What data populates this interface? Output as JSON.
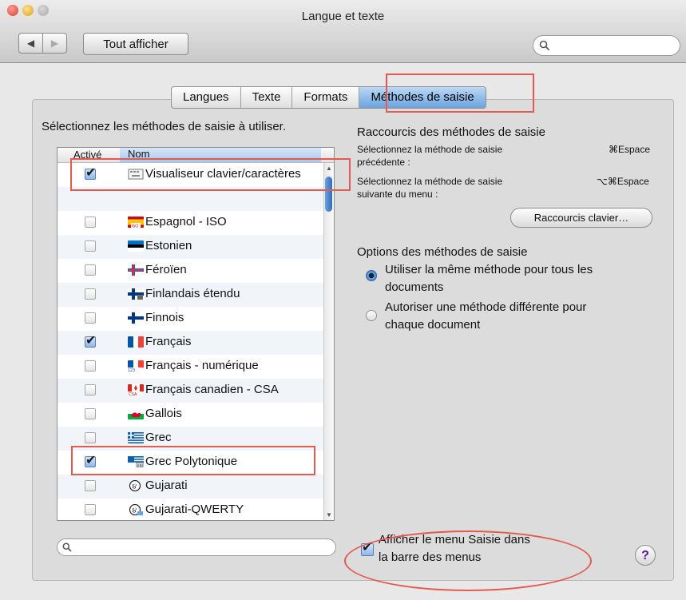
{
  "window": {
    "title": "Langue et texte"
  },
  "toolbar": {
    "back": "◀",
    "forward": "▶",
    "show_all": "Tout afficher",
    "search_icon": "search-icon"
  },
  "tabs": [
    {
      "label": "Langues"
    },
    {
      "label": "Texte"
    },
    {
      "label": "Formats"
    },
    {
      "label": "Méthodes de saisie",
      "active": true
    }
  ],
  "left": {
    "instruction": "Sélectionnez les méthodes de saisie à utiliser.",
    "columns": {
      "enabled": "Activé",
      "name": "Nom"
    },
    "items": [
      {
        "label": "Visualiseur clavier/caractères",
        "checked": true,
        "icon": "keyboard-viewer-icon"
      },
      {
        "label": "",
        "checked": false,
        "icon": ""
      },
      {
        "label": "Espagnol - ISO",
        "checked": false,
        "icon": "spain-iso-flag-icon"
      },
      {
        "label": "Estonien",
        "checked": false,
        "icon": "estonia-flag-icon"
      },
      {
        "label": "Féroïen",
        "checked": false,
        "icon": "faroe-flag-icon"
      },
      {
        "label": "Finlandais étendu",
        "checked": false,
        "icon": "finland-extended-flag-icon"
      },
      {
        "label": "Finnois",
        "checked": false,
        "icon": "finland-flag-icon"
      },
      {
        "label": "Français",
        "checked": true,
        "icon": "france-flag-icon"
      },
      {
        "label": "Français - numérique",
        "checked": false,
        "icon": "france-numeric-flag-icon"
      },
      {
        "label": "Français canadien - CSA",
        "checked": false,
        "icon": "canada-csa-flag-icon"
      },
      {
        "label": "Gallois",
        "checked": false,
        "icon": "wales-flag-icon"
      },
      {
        "label": "Grec",
        "checked": false,
        "icon": "greece-flag-icon"
      },
      {
        "label": "Grec Polytonique",
        "checked": true,
        "icon": "greece-polytonic-flag-icon"
      },
      {
        "label": "Gujarati",
        "checked": false,
        "icon": "gujarati-icon"
      },
      {
        "label": "Gujarati-QWERTY",
        "checked": false,
        "icon": "gujarati-qwerty-icon"
      }
    ]
  },
  "shortcuts": {
    "heading": "Raccourcis des méthodes de saisie",
    "prev_label_1": "Sélectionnez la méthode de saisie",
    "prev_label_2": "précédente :",
    "prev_key": "⌘Espace",
    "next_label_1": "Sélectionnez la méthode de saisie",
    "next_label_2": "suivante du menu :",
    "next_key": "⌥⌘Espace",
    "button": "Raccourcis clavier…"
  },
  "options": {
    "heading": "Options des méthodes de saisie",
    "same_1": "Utiliser la même méthode pour tous les",
    "same_2": "documents",
    "different_1": "Autoriser une méthode différente pour",
    "different_2": "chaque document",
    "selected": "same"
  },
  "menu_option": {
    "line1": "Afficher le menu Saisie dans",
    "line2": "la barre des menus",
    "checked": true
  },
  "help": "?",
  "colors": {
    "highlight_red": "#e55a4f",
    "selection_blue": "#6aa3df"
  }
}
